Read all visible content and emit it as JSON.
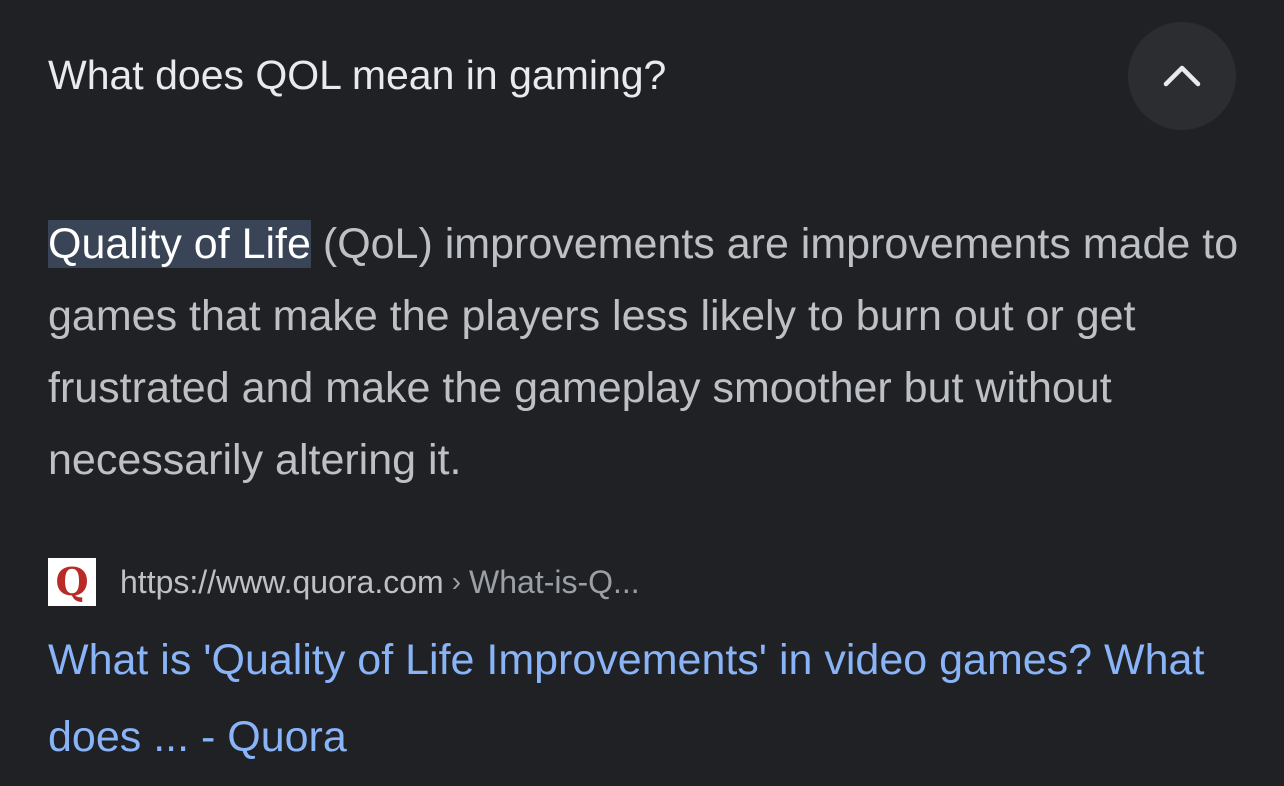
{
  "question": "What does QOL mean in gaming?",
  "collapse_icon": "chevron-up-icon",
  "answer": {
    "highlight": "Quality of Life",
    "text": " (QoL) improvements are improvements made to games that make the players less likely to burn out or get frustrated and make the gameplay smoother but without necessarily altering it."
  },
  "source": {
    "favicon_letter": "Q",
    "favicon_color": "#b92b27",
    "url": "https://www.quora.com",
    "separator": "›",
    "path": "What-is-Q..."
  },
  "result_title": "What is 'Quality of Life Improvements' in video games? What does ... - Quora",
  "colors": {
    "background": "#202124",
    "title_text": "#e8eaed",
    "body_text": "#bdc1c6",
    "link": "#8ab4f8",
    "highlight_bg": "#394457"
  }
}
